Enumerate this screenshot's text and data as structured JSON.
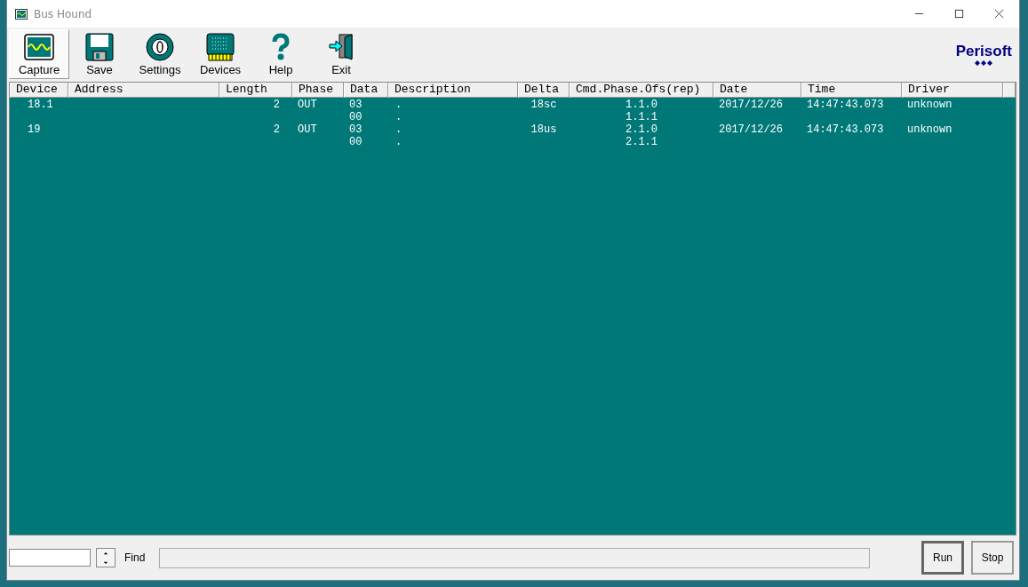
{
  "window": {
    "title": "Bus Hound"
  },
  "toolbar": [
    {
      "label": "Capture",
      "kind": "capture",
      "selected": true
    },
    {
      "label": "Save",
      "kind": "save",
      "selected": false
    },
    {
      "label": "Settings",
      "kind": "settings",
      "selected": false
    },
    {
      "label": "Devices",
      "kind": "devices",
      "selected": false
    },
    {
      "label": "Help",
      "kind": "help",
      "selected": false
    },
    {
      "label": "Exit",
      "kind": "exit",
      "selected": false
    }
  ],
  "logo": "Perisoft",
  "table": {
    "columns": [
      "Device",
      "Address",
      "Length",
      "Phase",
      "Data",
      "Description",
      "Delta",
      "Cmd.Phase.Ofs(rep)",
      "Date",
      "Time",
      "Driver"
    ],
    "rows": [
      {
        "cells": [
          [
            "18.1"
          ],
          null,
          [
            "2"
          ],
          [
            "OUT"
          ],
          [
            "03",
            "00"
          ],
          [
            ".",
            "."
          ],
          [
            "18sc"
          ],
          [
            "1.1.0",
            "1.1.1"
          ],
          [
            "2017/12/26"
          ],
          [
            "14:47:43.073"
          ],
          [
            "unknown"
          ]
        ]
      },
      {
        "cells": [
          [
            "19"
          ],
          null,
          [
            "2"
          ],
          [
            "OUT"
          ],
          [
            "03",
            "00"
          ],
          [
            ".",
            "."
          ],
          [
            "18us"
          ],
          [
            "2.1.0",
            "2.1.1"
          ],
          [
            "2017/12/26"
          ],
          [
            "14:47:43.073"
          ],
          [
            "unknown"
          ]
        ]
      }
    ]
  },
  "find": {
    "label": "Find"
  },
  "buttons": [
    {
      "label": "Run",
      "kind": "run"
    },
    {
      "label": "Stop",
      "kind": "stop"
    }
  ]
}
